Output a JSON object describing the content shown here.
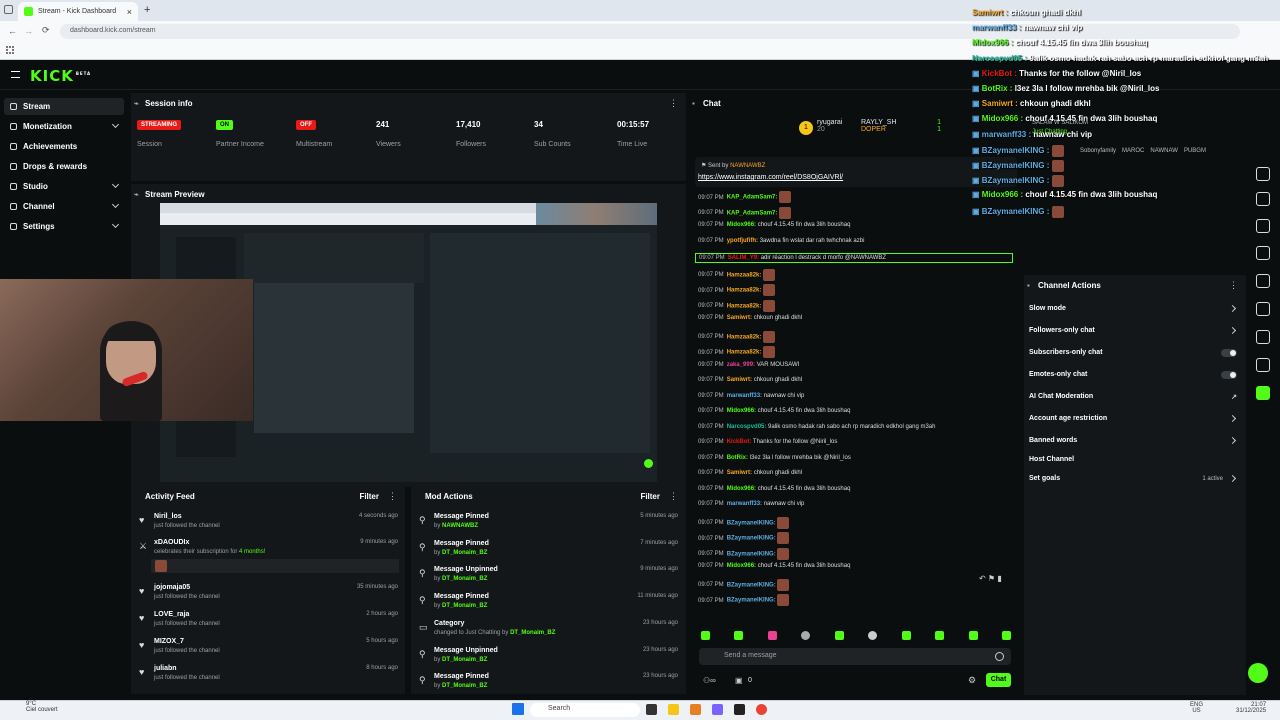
{
  "browser": {
    "tab_title": "Stream - Kick Dashboard",
    "url": "dashboard.kick.com/stream",
    "new_tab": "+",
    "close": "×"
  },
  "brand": {
    "logo": "KICK",
    "beta": "BETA"
  },
  "sidebar": {
    "items": [
      {
        "label": "Stream",
        "active": true
      },
      {
        "label": "Monetization",
        "expand": true
      },
      {
        "label": "Achievements"
      },
      {
        "label": "Drops & rewards"
      },
      {
        "label": "Studio",
        "expand": true
      },
      {
        "label": "Channel",
        "expand": true
      },
      {
        "label": "Settings",
        "expand": true
      }
    ]
  },
  "session": {
    "title": "Session info",
    "stats": [
      {
        "value": "STREAMING",
        "label": "Session",
        "badge": "#e91916"
      },
      {
        "value": "ON",
        "label": "Partner Income",
        "badge": "#53fc18"
      },
      {
        "value": "OFF",
        "label": "Multistream",
        "badge": "#e91916"
      },
      {
        "value": "241",
        "label": "Viewers"
      },
      {
        "value": "17,410",
        "label": "Followers"
      },
      {
        "value": "34",
        "label": "Sub Counts"
      },
      {
        "value": "00:15:57",
        "label": "Time Live"
      }
    ]
  },
  "preview": {
    "title": "Stream Preview"
  },
  "activity": {
    "title": "Activity Feed",
    "filter": "Filter",
    "items": [
      {
        "name": "Niril_los",
        "sub": "just followed the channel",
        "time": "4 seconds ago"
      },
      {
        "name": "xDAOUDIx",
        "sub": "celebrates their subscription for",
        "months": "4 months!",
        "time": "9 minutes ago"
      },
      {
        "name": "jojomaja05",
        "sub": "just followed the channel",
        "time": "35 minutes ago"
      },
      {
        "name": "LOVE_raja",
        "sub": "just followed the channel",
        "time": "2 hours ago"
      },
      {
        "name": "MIZOX_7",
        "sub": "just followed the channel",
        "time": "5 hours ago"
      },
      {
        "name": "juliabn",
        "sub": "just followed the channel",
        "time": "8 hours ago"
      }
    ]
  },
  "mod": {
    "title": "Mod Actions",
    "filter": "Filter",
    "items": [
      {
        "action": "Message Pinned",
        "by": "by",
        "who": "NAWNAWBZ",
        "time": "5 minutes ago"
      },
      {
        "action": "Message Pinned",
        "by": "by",
        "who": "DT_Monaim_BZ",
        "time": "7 minutes ago"
      },
      {
        "action": "Message Unpinned",
        "by": "by",
        "who": "DT_Monaim_BZ",
        "time": "9 minutes ago"
      },
      {
        "action": "Message Pinned",
        "by": "by",
        "who": "DT_Monaim_BZ",
        "time": "11 minutes ago"
      },
      {
        "action": "Category",
        "by": "changed to Just Chatting by",
        "who": "DT_Monaim_BZ",
        "time": "23 hours ago"
      },
      {
        "action": "Message Unpinned",
        "by": "by",
        "who": "DT_Monaim_BZ",
        "time": "23 hours ago"
      },
      {
        "action": "Message Pinned",
        "by": "by",
        "who": "DT_Monaim_BZ",
        "time": "23 hours ago"
      }
    ]
  },
  "chat": {
    "title": "Chat",
    "leader": [
      {
        "name": "ryugarai",
        "value": "20"
      },
      {
        "name": "RAYLY_SH",
        "value": "1"
      },
      {
        "name": "DOPER",
        "value": "1"
      }
    ],
    "pinned_by": "Sent by",
    "pinned_user": "NAWNAWBZ",
    "pinned_link": "https://www.instagram.com/reel/DS8OjGAIVRl/",
    "lines": [
      {
        "t": "09:07 PM",
        "u": "KAP_AdamSam7:",
        "m": "",
        "c": "#53fc18",
        "e": 1
      },
      {
        "t": "09:07 PM",
        "u": "KAP_AdamSam7:",
        "m": "",
        "c": "#53fc18",
        "e": 1
      },
      {
        "t": "09:07 PM",
        "u": "Midox966:",
        "m": "chouf 4.15.45 fin dwa 3lih boushaq",
        "c": "#53fc18"
      },
      {
        "t": "09:07 PM",
        "u": "ypotfjufifh:",
        "m": "3awdna fin wslat dar rah twhchnak azbi",
        "c": "#f5a623"
      },
      {
        "t": "09:07 PM",
        "u": "SALIM_Y9:",
        "m": "adir réaction l destrack d morfo @NAWNAWBZ",
        "c": "#e91916",
        "hl": true
      },
      {
        "t": "09:07 PM",
        "u": "Hamzaa82k:",
        "m": "",
        "c": "#f5a623",
        "e": 1
      },
      {
        "t": "09:07 PM",
        "u": "Hamzaa82k:",
        "m": "",
        "c": "#f5a623",
        "e": 1
      },
      {
        "t": "09:07 PM",
        "u": "Hamzaa82k:",
        "m": "",
        "c": "#f5a623",
        "e": 1
      },
      {
        "t": "09:07 PM",
        "u": "Samiwrt:",
        "m": "chkoun ghadi dkhl",
        "c": "#f5a623"
      },
      {
        "t": "09:07 PM",
        "u": "Hamzaa82k:",
        "m": "",
        "c": "#f5a623",
        "e": 1
      },
      {
        "t": "09:07 PM",
        "u": "Hamzaa82k:",
        "m": "",
        "c": "#f5a623",
        "e": 1
      },
      {
        "t": "09:07 PM",
        "u": "zaka_999:",
        "m": "VAR MOUSAWI",
        "c": "#e84393"
      },
      {
        "t": "09:07 PM",
        "u": "Samiwrt:",
        "m": "chkoun ghadi dkhl",
        "c": "#f5a623"
      },
      {
        "t": "09:07 PM",
        "u": "marwanff33:",
        "m": "nawnaw chi vip",
        "c": "#5dade2"
      },
      {
        "t": "09:07 PM",
        "u": "Midox966:",
        "m": "chouf 4.15.45 fin dwa 3lih boushaq",
        "c": "#53fc18"
      },
      {
        "t": "09:07 PM",
        "u": "Narcospvd05:",
        "m": "9alik osmo hadak rah sabo ach rp maradich edkhol gang m3ah",
        "c": "#1abc9c"
      },
      {
        "t": "09:07 PM",
        "u": "KickBot:",
        "m": "Thanks for the follow @Niril_los",
        "c": "#e91916"
      },
      {
        "t": "09:07 PM",
        "u": "BotRix:",
        "m": "l3ez 3la l follow mrehba bik @Niril_los",
        "c": "#53fc18"
      },
      {
        "t": "09:07 PM",
        "u": "Samiwrt:",
        "m": "chkoun ghadi dkhl",
        "c": "#f5a623"
      },
      {
        "t": "09:07 PM",
        "u": "Midox966:",
        "m": "chouf 4.15.45 fin dwa 3lih boushaq",
        "c": "#53fc18"
      },
      {
        "t": "09:07 PM",
        "u": "marwanff33:",
        "m": "nawnaw chi vip",
        "c": "#5dade2"
      },
      {
        "t": "09:07 PM",
        "u": "BZaymanelKING:",
        "m": "",
        "c": "#5dade2",
        "e": 1
      },
      {
        "t": "09:07 PM",
        "u": "BZaymanelKING:",
        "m": "",
        "c": "#5dade2",
        "e": 1
      },
      {
        "t": "09:07 PM",
        "u": "BZaymanelKING:",
        "m": "",
        "c": "#5dade2",
        "e": 1
      },
      {
        "t": "09:07 PM",
        "u": "Midox966:",
        "m": "chouf 4.15.45 fin dwa 3lih boushaq",
        "c": "#53fc18"
      },
      {
        "t": "09:07 PM",
        "u": "BZaymanelKING:",
        "m": "",
        "c": "#5dade2",
        "e": 1
      },
      {
        "t": "09:07 PM",
        "u": "BZaymanelKING:",
        "m": "",
        "c": "#5dade2",
        "e": 1
      }
    ],
    "placeholder": "Send a message",
    "chat_button": "Chat",
    "count": "0"
  },
  "actions": {
    "title": "Channel Actions",
    "items": [
      {
        "label": "Slow mode",
        "kind": "arrow"
      },
      {
        "label": "Followers-only chat",
        "kind": "arrow"
      },
      {
        "label": "Subscribers-only chat",
        "kind": "toggle"
      },
      {
        "label": "Emotes-only chat",
        "kind": "toggle"
      },
      {
        "label": "AI Chat Moderation",
        "kind": "ext"
      },
      {
        "label": "Account age restriction",
        "kind": "arrow"
      },
      {
        "label": "Banned words",
        "kind": "arrow"
      },
      {
        "label": "Host Channel",
        "kind": "none"
      },
      {
        "label": "Set goals",
        "kind": "arrow",
        "extra": "1 active"
      }
    ]
  },
  "overlay": {
    "lines": [
      {
        "u": "Samiwrt :",
        "m": "chkoun ghadi dkhl",
        "c": "#f5a623"
      },
      {
        "u": "marwanff33 :",
        "m": "nawnaw chi vip",
        "c": "#5dade2"
      },
      {
        "u": "Midox966 :",
        "m": "chouf 4.15.45 fin dwa 3lih boushaq",
        "c": "#53fc18"
      },
      {
        "u": "Narcospvd05 :",
        "m": "9alik osmo hadak rah sabo ach rp maradich edkhol gang m3ah",
        "c": "#1abc9c"
      },
      {
        "u": "KickBot :",
        "m": "Thanks for the follow @Niril_los",
        "c": "#e91916"
      },
      {
        "u": "BotRix :",
        "m": "l3ez 3la l follow mrehba bik @Niril_los",
        "c": "#53fc18"
      },
      {
        "u": "Samiwrt :",
        "m": "chkoun ghadi dkhl",
        "c": "#f5a623"
      },
      {
        "u": "Midox966 :",
        "m": "chouf 4.15.45 fin dwa 3lih boushaq",
        "c": "#53fc18"
      },
      {
        "u": "marwanff33 :",
        "m": "nawnaw chi vip",
        "c": "#5dade2"
      },
      {
        "u": "BZaymanelKING :",
        "m": "",
        "c": "#5dade2"
      },
      {
        "u": "BZaymanelKING :",
        "m": "",
        "c": "#5dade2"
      },
      {
        "u": "BZaymanelKING :",
        "m": "",
        "c": "#5dade2"
      },
      {
        "u": "Midox966 :",
        "m": "chouf 4.15.45 fin dwa 3lih boushaq",
        "c": "#53fc18"
      },
      {
        "u": "BZaymanelKING :",
        "m": "",
        "c": "#5dade2"
      }
    ],
    "tags": [
      "SALAM W SALIKOM",
      "Just Chatting",
      "Sobonyfamily",
      "MAROC",
      "NAWNAW",
      "PUBGM"
    ]
  },
  "taskbar": {
    "weather_temp": "9°C",
    "weather": "Ciel couvert",
    "search": "Search",
    "lang": "ENG",
    "region": "US",
    "time": "21:07",
    "date": "31/12/2025"
  }
}
